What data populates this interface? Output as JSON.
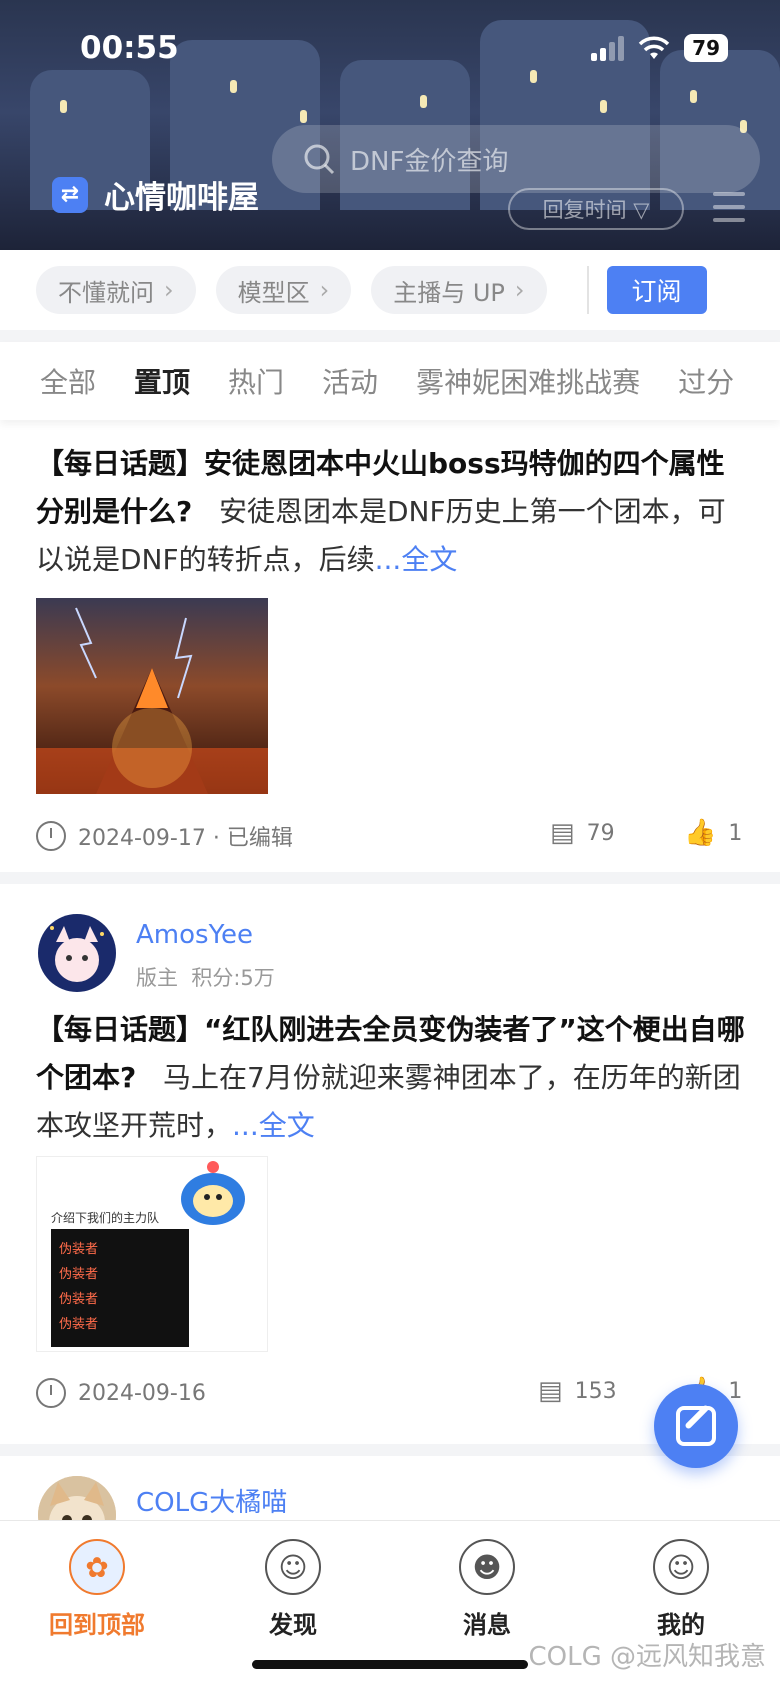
{
  "status_bar": {
    "time": "00:55",
    "battery": "79"
  },
  "header": {
    "search_placeholder": "DNF金价查询",
    "club_name": "心情咖啡屋",
    "club_icon": "swap-icon",
    "sort_label": "回复时间 ▽"
  },
  "channels": {
    "chips": [
      "不懂就问",
      "模型区",
      "主播与 UP"
    ],
    "subscribe_label": "订阅"
  },
  "tabs": [
    "全部",
    "置顶",
    "热门",
    "活动",
    "雾神妮困难挑战赛",
    "过分"
  ],
  "active_tab": "置顶",
  "posts": [
    {
      "title": "【每日话题】安徒恩团本中火山boss玛特伽的四个属性分别是什么?",
      "excerpt": "安徒恩团本是DNF历史上第一个团本，可以说是DNF的转折点，后续",
      "more": "...全文",
      "date": "2024-09-17 · 已编辑",
      "comments": "79",
      "likes": "1"
    },
    {
      "username": "AmosYee",
      "role": "版主",
      "points": "积分:5万",
      "title": "【每日话题】“红队刚进去全员变伪装者了”这个梗出自哪个团本?",
      "excerpt": "马上在7月份就迎来雾神团本了，在历年的新团本攻坚开荒时，",
      "more": "...全文",
      "image_caption": "介绍下我们的主力队",
      "image_rows": [
        "伪装者",
        "伪装者",
        "伪装者",
        "伪装者"
      ],
      "date": "2024-09-16",
      "comments": "153",
      "likes": "1"
    },
    {
      "username": "COLG大橘喵"
    }
  ],
  "bottom_nav": [
    {
      "label": "回到顶部",
      "icon": "mascot-icon"
    },
    {
      "label": "发现",
      "icon": "discover-icon"
    },
    {
      "label": "消息",
      "icon": "message-icon"
    },
    {
      "label": "我的",
      "icon": "profile-icon"
    }
  ],
  "watermark": "COLG @远风知我意",
  "colors": {
    "accent": "#4d80f3",
    "active_nav": "#f07a2e"
  }
}
